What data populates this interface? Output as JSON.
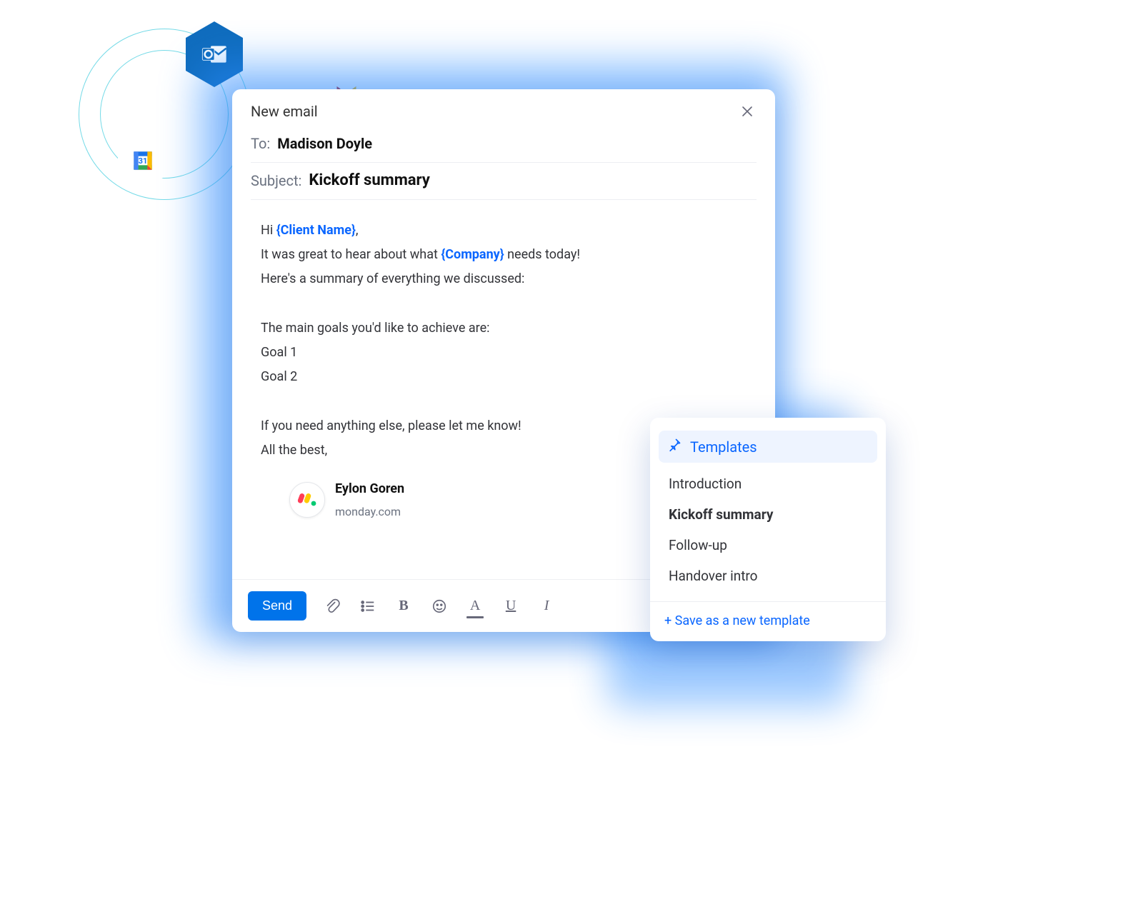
{
  "badges": {
    "outlook_label": "Outlook",
    "gmail_label": "Gmail",
    "gcal_label": "Google Calendar",
    "gcal_day": "31"
  },
  "compose": {
    "title": "New email",
    "to_label": "To:",
    "to_value": "Madison Doyle",
    "subject_label": "Subject:",
    "subject_value": "Kickoff summary",
    "body": {
      "greeting_prefix": "Hi ",
      "greeting_tag": "{Client Name}",
      "greeting_suffix": ",",
      "l2a": "It was great to hear about what ",
      "l2tag": "{Company}",
      "l2b": " needs today!",
      "l3": "Here's a summary of everything we discussed:",
      "l4": "The main goals you'd like to achieve are:",
      "l5": "Goal 1",
      "l6": "Goal 2",
      "l7": "If you need anything else, please let me know!",
      "l8": "All the best,"
    },
    "signature": {
      "name": "Eylon Goren",
      "company": "monday.com"
    },
    "toolbar": {
      "send": "Send",
      "bold": "B",
      "fontcolor": "A",
      "underline": "U",
      "italic": "I"
    }
  },
  "popover": {
    "title": "Templates",
    "items": [
      {
        "label": "Introduction",
        "active": false
      },
      {
        "label": "Kickoff summary",
        "active": true
      },
      {
        "label": "Follow-up",
        "active": false
      },
      {
        "label": "Handover intro",
        "active": false
      }
    ],
    "save": "+ Save as a new template"
  }
}
